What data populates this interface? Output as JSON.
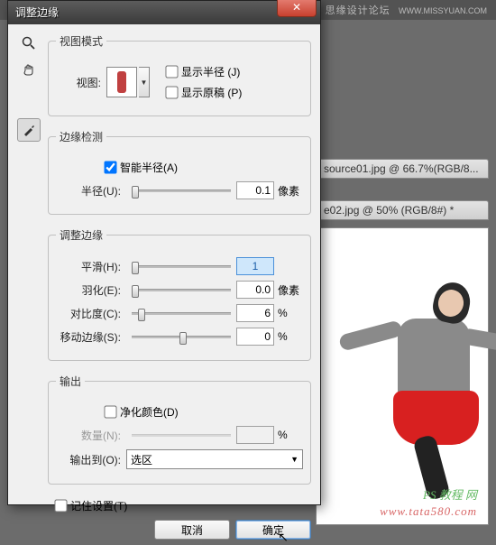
{
  "header": {
    "brand": "思缘设计论坛",
    "site": "WWW.MISSYUAN.COM"
  },
  "doc_tabs": [
    "source01.jpg @ 66.7%(RGB/8...",
    "e02.jpg @ 50% (RGB/8#) *"
  ],
  "watermarks": {
    "line1": "PS 教程 网",
    "line2": "www.tata580.com"
  },
  "dialog": {
    "title": "调整边缘",
    "close_glyph": "✕",
    "view_mode": {
      "legend": "视图模式",
      "view_label": "视图:",
      "show_radius": "显示半径 (J)",
      "show_original": "显示原稿 (P)"
    },
    "edge_detect": {
      "legend": "边缘检测",
      "smart_radius": "智能半径(A)",
      "radius_label": "半径(U):",
      "radius_value": "0.1",
      "radius_unit": "像素"
    },
    "adjust": {
      "legend": "调整边缘",
      "smooth_label": "平滑(H):",
      "smooth_value": "1",
      "feather_label": "羽化(E):",
      "feather_value": "0.0",
      "feather_unit": "像素",
      "contrast_label": "对比度(C):",
      "contrast_value": "6",
      "contrast_unit": "%",
      "shift_label": "移动边缘(S):",
      "shift_value": "0",
      "shift_unit": "%"
    },
    "output": {
      "legend": "输出",
      "decontaminate": "净化颜色(D)",
      "amount_label": "数量(N):",
      "amount_value": "",
      "output_to_label": "输出到(O):",
      "output_to_value": "选区"
    },
    "remember": "记住设置(T)",
    "cancel": "取消",
    "ok": "确定"
  }
}
